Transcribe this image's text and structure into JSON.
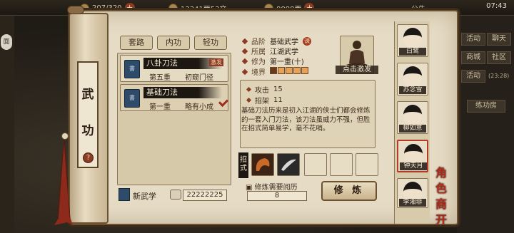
{
  "topbar": {
    "stamina": "207/320",
    "money": "13341两53文",
    "gems": "8888两",
    "announcement": "公告",
    "clock": "07:43"
  },
  "left_edge": {
    "label": "面"
  },
  "right_menu": {
    "items": [
      "活动",
      "聊天",
      "商城",
      "社区",
      "活动"
    ],
    "timer": "(23:28)",
    "hint": "练功房"
  },
  "scroll_title": [
    "武",
    "功"
  ],
  "help_icon": "?",
  "tabs": [
    "套路",
    "内功",
    "轻功"
  ],
  "martial_arts": [
    {
      "name": "八卦刀法",
      "level": "第五重",
      "progress": "初窥门径",
      "badge": "激发",
      "book": "書"
    },
    {
      "name": "基础刀法",
      "level": "第一重",
      "progress": "略有小成",
      "book": "書"
    }
  ],
  "new_arts": {
    "label": "新武学",
    "value": "22222225"
  },
  "info": {
    "rank_label": "品阶",
    "rank": "基础武学",
    "rank_seal": "谏",
    "school_label": "所属",
    "school": "江湖武学",
    "cultivation_label": "修为",
    "cultivation": "第一重(十)",
    "realm_label": "境界",
    "realm_filled": 1,
    "realm_total": 5
  },
  "avatar": {
    "label": "点击激发"
  },
  "stats": [
    {
      "label": "攻击",
      "value": "15"
    },
    {
      "label": "招架",
      "value": "11"
    }
  ],
  "description": "基础刀法历来是初入江湖的侠士们都会修炼的一套入门刀法，该刀法虽威力不强，但胜在招式简单易学，毫不花哨。",
  "skills": {
    "label": "招式",
    "slots": 6
  },
  "train": {
    "req_label": "修炼需要阅历",
    "req_value": "8",
    "button": "修 炼"
  },
  "characters": [
    {
      "name": "白鹭"
    },
    {
      "name": "苏念雪"
    },
    {
      "name": "柳如意"
    },
    {
      "name": "钟天月"
    },
    {
      "name": "李湘菲"
    }
  ],
  "role_stamp": "角色\n商开",
  "colors": {
    "accent": "#8c3b25",
    "paper": "#e6dcc6",
    "ink": "#2b1c10"
  }
}
